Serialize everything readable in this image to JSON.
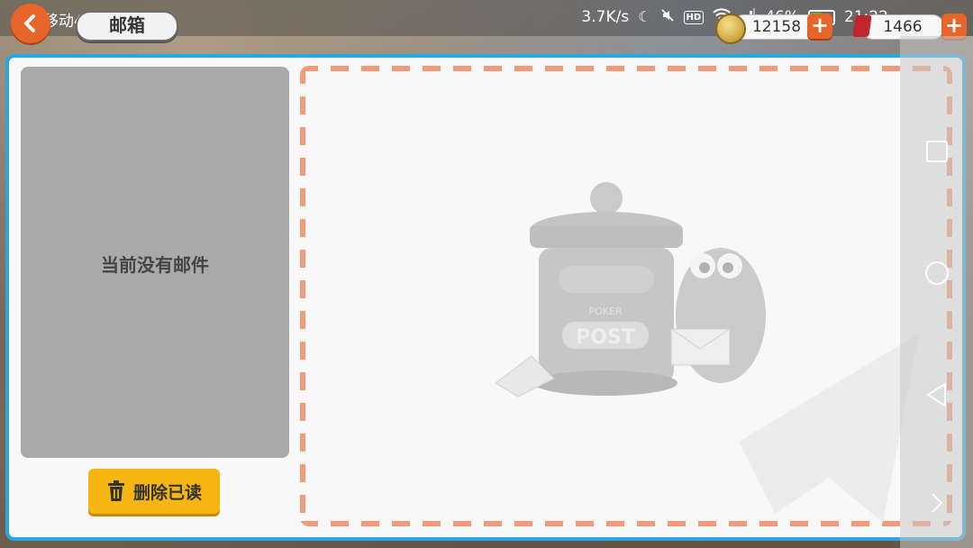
{
  "status_bar": {
    "carrier": "中国移动4G",
    "net_speed": "3.7K/s",
    "battery_percent": "46%",
    "battery_level": 0.46,
    "time": "21:22",
    "icons": [
      "moon-icon",
      "mute-icon",
      "hd-icon",
      "wifi-icon",
      "signal-icon",
      "battery-icon"
    ]
  },
  "header": {
    "title": "邮箱",
    "coins": "12158",
    "gems": "1466",
    "plus_label": "+"
  },
  "mail_list": {
    "empty_message": "当前没有邮件"
  },
  "actions": {
    "delete_read_label": "删除已读"
  },
  "illustration": {
    "mailbox_label": "POST",
    "mailbox_sublabel": "POKER"
  },
  "colors": {
    "accent_orange": "#e8652a",
    "panel_border_blue": "#28a8de",
    "delete_button_yellow": "#f5b612",
    "dashed_border": "#f29a7a"
  }
}
